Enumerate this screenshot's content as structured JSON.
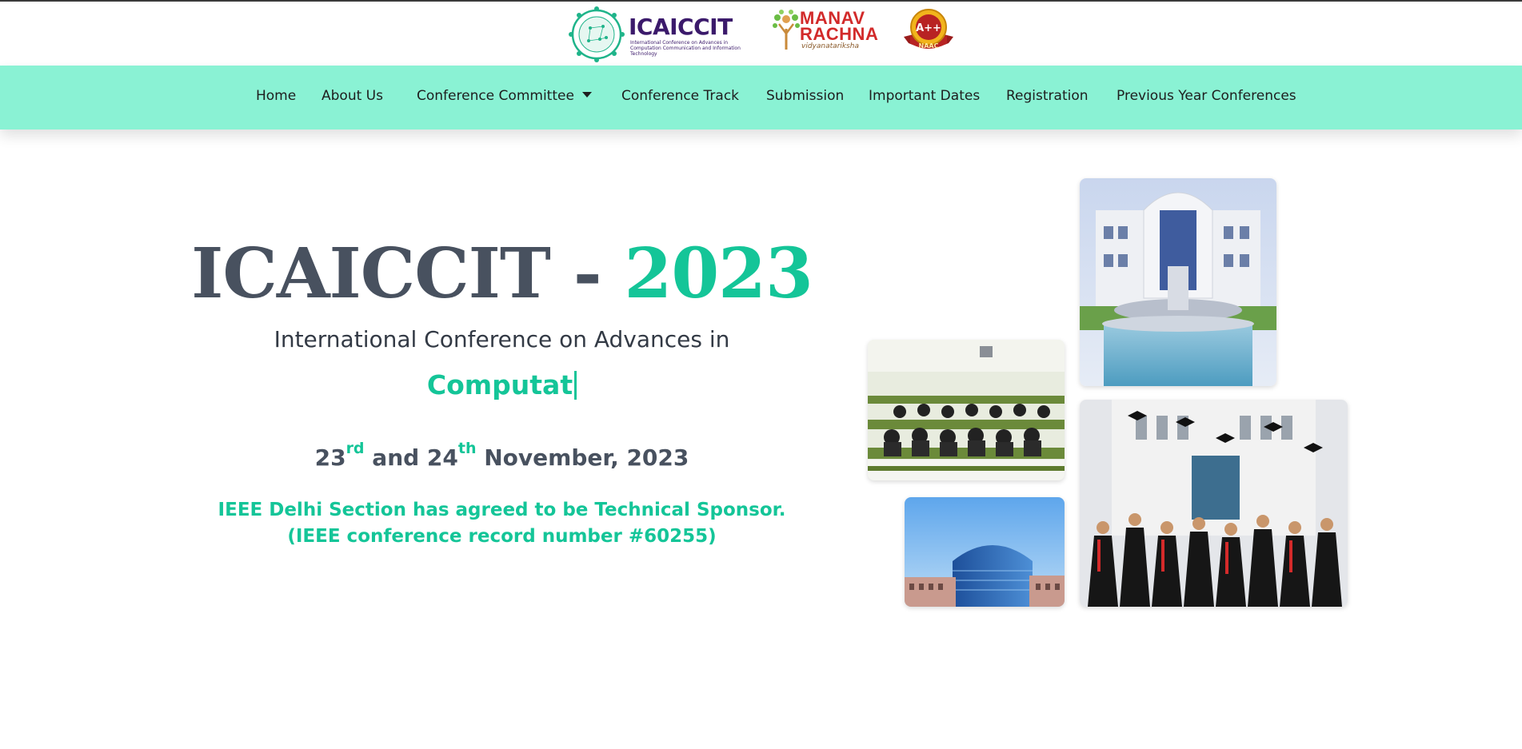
{
  "header": {
    "logo_main": {
      "name": "ICAICCIT",
      "subtitle": "International Conference on Advances in Computation Communication and Information Technology"
    },
    "logo_partner": {
      "line1": "MANAV",
      "line2": "RACHNA",
      "tagline": "vidyanatariksha"
    },
    "logo_naac": {
      "grade": "A++",
      "label": "NAAC"
    }
  },
  "nav": {
    "items": [
      {
        "label": "Home"
      },
      {
        "label": "About Us"
      },
      {
        "label": "Conference Committee"
      },
      {
        "label": "Conference Track"
      },
      {
        "label": "Submission"
      },
      {
        "label": "Important Dates"
      },
      {
        "label": "Registration"
      },
      {
        "label": "Previous Year Conferences"
      }
    ]
  },
  "hero": {
    "title_main": "ICAICCIT - ",
    "title_year": "2023",
    "subtitle": "International Conference on Advances in",
    "typed_text": "Computat",
    "date_day1": "23",
    "date_sup1": "rd",
    "date_and": " and 24",
    "date_sup2": "th",
    "date_rest": " November, 2023",
    "sponsor_note": "IEEE Delhi Section has agreed to be Technical Sponsor.(IEEE conference record number #60255)"
  },
  "colors": {
    "accent": "#14c598",
    "nav_bg": "#8af2d4",
    "title_gray": "#48515f"
  },
  "photos": [
    {
      "name": "campus-fountain-photo"
    },
    {
      "name": "classroom-photo"
    },
    {
      "name": "graduation-photo"
    },
    {
      "name": "glass-building-photo"
    }
  ]
}
